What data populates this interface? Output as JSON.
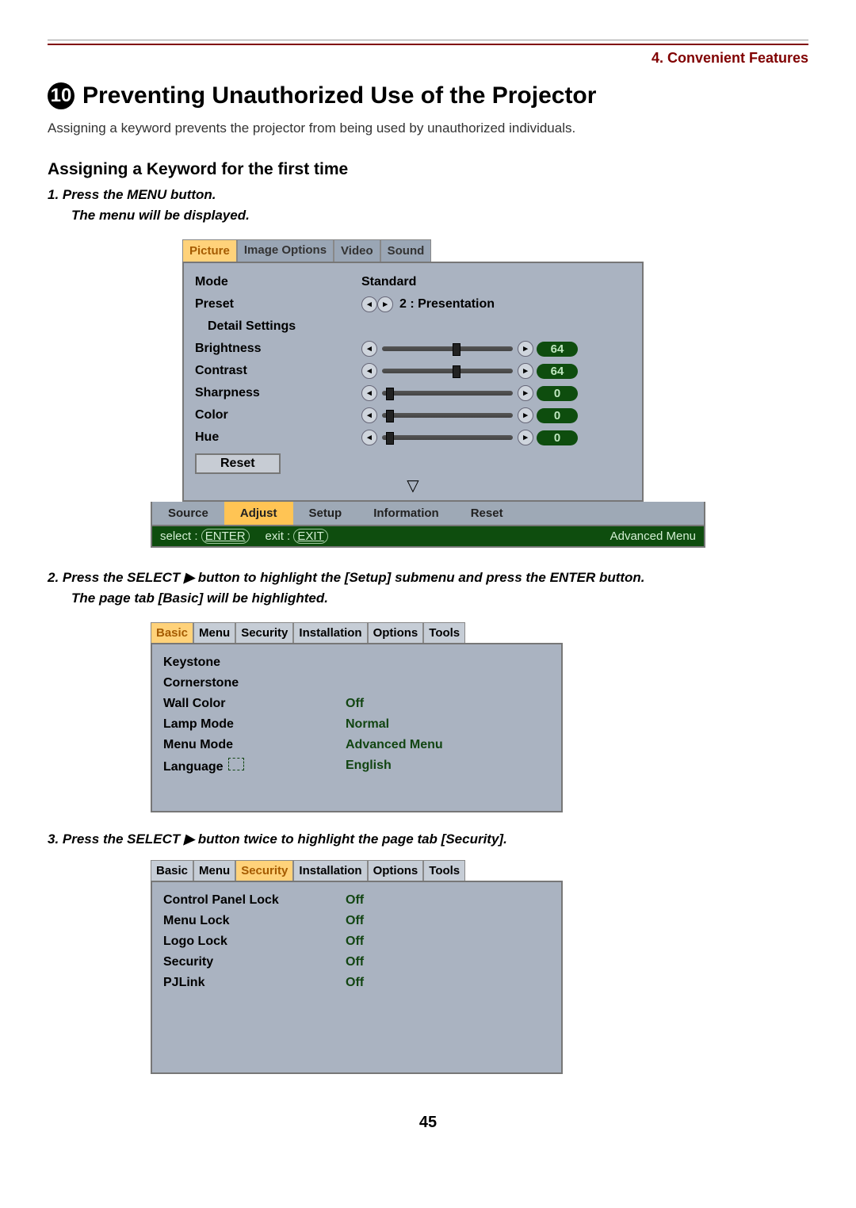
{
  "chapter": "4. Convenient Features",
  "section_number": "10",
  "section_title": "Preventing Unauthorized Use of the Projector",
  "lead": "Assigning a keyword prevents the projector from being used by unauthorized individuals.",
  "sub_heading": "Assigning a Keyword for the first time",
  "step1": "1.  Press the MENU button.",
  "step1_sub": "The menu will be displayed.",
  "step2": "2.  Press the SELECT ▶ button to highlight the [Setup] submenu and press the ENTER button.",
  "step2_sub": "The page tab [Basic] will be highlighted.",
  "step3": "3.  Press the SELECT ▶ button twice to highlight the page tab [Security].",
  "page_number": "45",
  "osd1": {
    "tabs": [
      "Picture",
      "Image Options",
      "Video",
      "Sound"
    ],
    "active_tab": "Picture",
    "rows": {
      "mode_label": "Mode",
      "mode_value": "Standard",
      "preset_label": "Preset",
      "preset_value": "2 : Presentation",
      "detail_label": "Detail Settings",
      "brightness_label": "Brightness",
      "brightness_value": "64",
      "contrast_label": "Contrast",
      "contrast_value": "64",
      "sharpness_label": "Sharpness",
      "sharpness_value": "0",
      "color_label": "Color",
      "color_value": "0",
      "hue_label": "Hue",
      "hue_value": "0",
      "reset_label": "Reset"
    },
    "bottom": {
      "source": "Source",
      "adjust": "Adjust",
      "setup": "Setup",
      "information": "Information",
      "reset": "Reset"
    },
    "status": {
      "select_prefix": "select :",
      "select_key": "ENTER",
      "exit_prefix": "exit :",
      "exit_key": "EXIT",
      "mode": "Advanced Menu"
    }
  },
  "osd2": {
    "tabs": [
      "Basic",
      "Menu",
      "Security",
      "Installation",
      "Options",
      "Tools"
    ],
    "active_tab": "Basic",
    "rows": [
      {
        "label": "Keystone",
        "value": ""
      },
      {
        "label": "Cornerstone",
        "value": ""
      },
      {
        "label": "Wall Color",
        "value": "Off"
      },
      {
        "label": "Lamp Mode",
        "value": "Normal"
      },
      {
        "label": "Menu Mode",
        "value": "Advanced Menu"
      },
      {
        "label": "Language",
        "value": "English",
        "flag": true
      }
    ]
  },
  "osd3": {
    "tabs": [
      "Basic",
      "Menu",
      "Security",
      "Installation",
      "Options",
      "Tools"
    ],
    "active_tab": "Security",
    "rows": [
      {
        "label": "Control Panel Lock",
        "value": "Off"
      },
      {
        "label": "Menu Lock",
        "value": "Off"
      },
      {
        "label": "Logo Lock",
        "value": "Off"
      },
      {
        "label": "Security",
        "value": "Off"
      },
      {
        "label": "PJLink",
        "value": "Off"
      }
    ]
  }
}
